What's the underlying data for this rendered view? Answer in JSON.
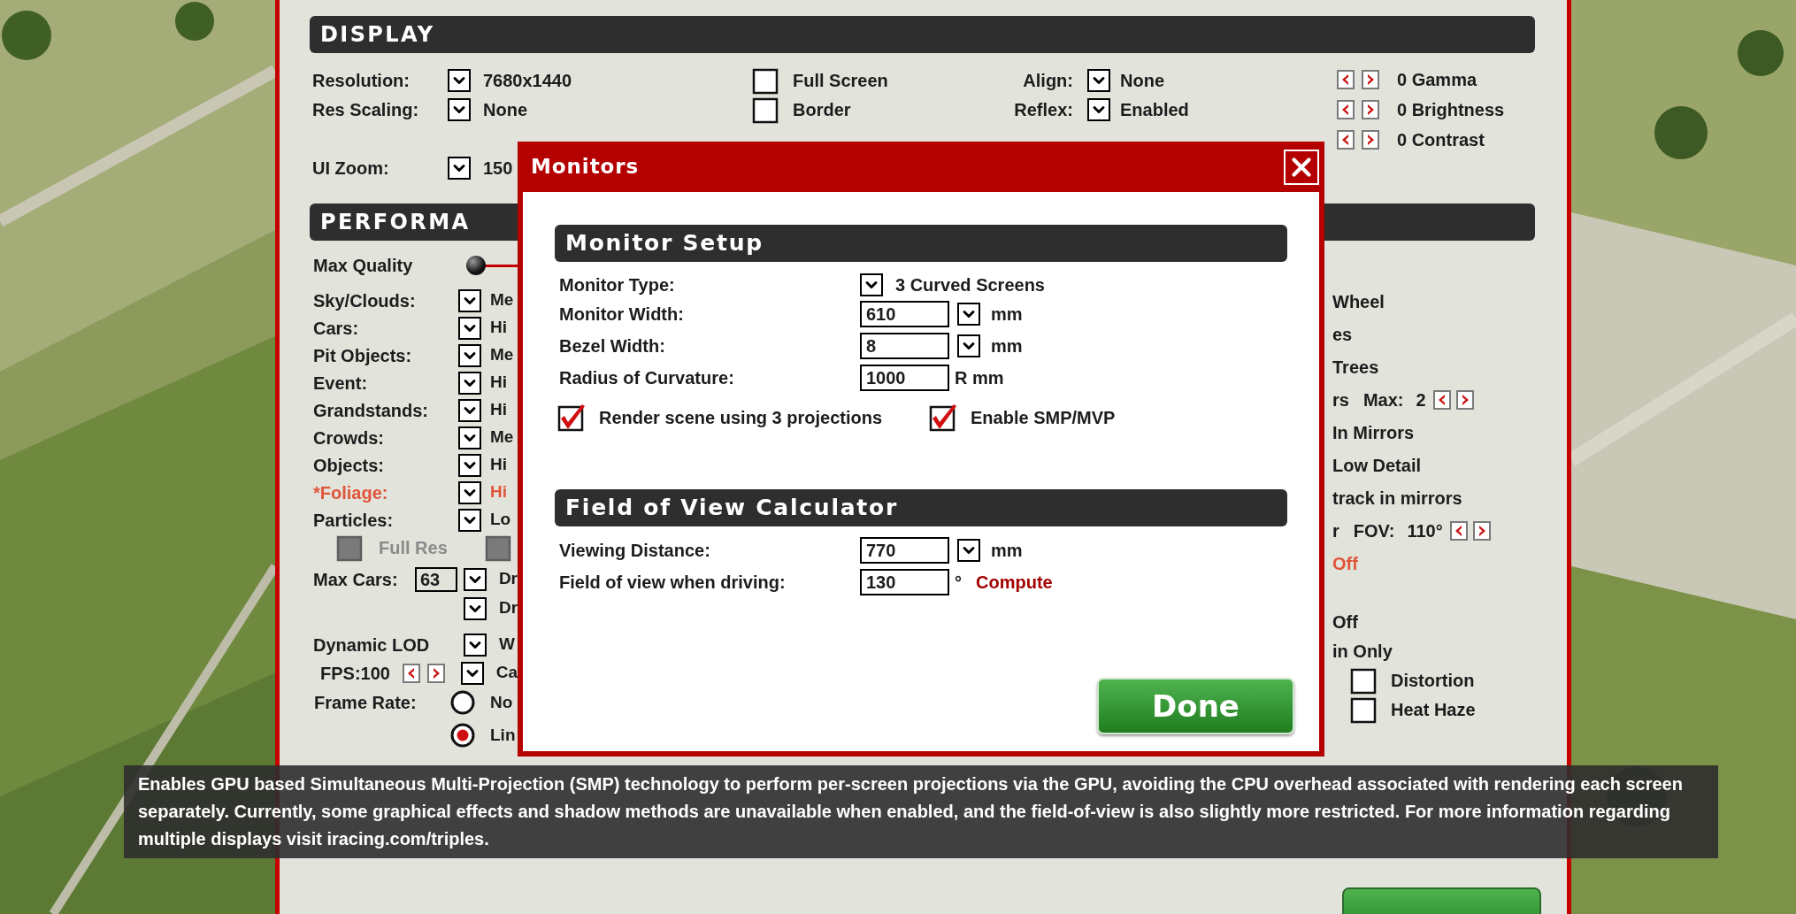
{
  "display": {
    "title": "DISPLAY",
    "left_rows": [
      {
        "label": "Resolution:",
        "value": "7680x1440"
      },
      {
        "label": "Res Scaling:",
        "value": "None"
      },
      {
        "label": "UI Zoom:",
        "value": "150"
      }
    ],
    "toggles": [
      {
        "label": "Full Screen",
        "checked": false
      },
      {
        "label": "Border",
        "checked": false
      }
    ],
    "options": [
      {
        "label": "Align:",
        "value": "None"
      },
      {
        "label": "Reflex:",
        "value": "Enabled"
      }
    ],
    "adjusters": [
      {
        "label": "0 Gamma"
      },
      {
        "label": "0 Brightness"
      },
      {
        "label": "0 Contrast"
      }
    ]
  },
  "performance": {
    "title": "PERFORMA",
    "quality": {
      "label": "Max Quality",
      "level": 0
    },
    "rows": [
      {
        "label": "Sky/Clouds:",
        "value": "Me",
        "highlighted": false
      },
      {
        "label": "Cars:",
        "value": "Hi",
        "highlighted": false
      },
      {
        "label": "Pit Objects:",
        "value": "Me",
        "highlighted": false
      },
      {
        "label": "Event:",
        "value": "Hi",
        "highlighted": false
      },
      {
        "label": "Grandstands:",
        "value": "Hi",
        "highlighted": false
      },
      {
        "label": "Crowds:",
        "value": "Me",
        "highlighted": false
      },
      {
        "label": "Objects:",
        "value": "Hi",
        "highlighted": false
      },
      {
        "label": "*Foliage:",
        "value": "Hi",
        "highlighted": true
      },
      {
        "label": "Particles:",
        "value": "Lo",
        "highlighted": false
      }
    ],
    "full_res": {
      "label": "Full Res",
      "checked": false,
      "disabled": true,
      "second_checked": false,
      "second_disabled": true
    },
    "max_cars": {
      "label": "Max Cars:",
      "field": "63",
      "value": "Dr"
    },
    "second_value": "Dr",
    "lod": {
      "label": "Dynamic LOD",
      "value": "W"
    },
    "fps": {
      "label": "FPS:100",
      "value": "Ca"
    },
    "frame_rate": {
      "label": "Frame Rate:",
      "options": [
        {
          "label": "No",
          "selected": false
        },
        {
          "label": "Lin",
          "selected": true
        }
      ]
    },
    "right_items": [
      {
        "kind": "text",
        "text": "Wheel",
        "highlighted": false
      },
      {
        "kind": "text",
        "text": "es",
        "highlighted": false
      },
      {
        "kind": "text",
        "text": "Trees",
        "highlighted": false
      },
      {
        "kind": "stepper",
        "prefix": "rs",
        "label": "Max:",
        "value": "2"
      },
      {
        "kind": "text",
        "text": "In Mirrors",
        "highlighted": false
      },
      {
        "kind": "text",
        "text": "Low Detail",
        "highlighted": false
      },
      {
        "kind": "text",
        "text": "track in mirrors",
        "highlighted": false
      },
      {
        "kind": "stepper",
        "prefix": "r",
        "label": "FOV:",
        "value": "110°"
      },
      {
        "kind": "text",
        "text": "Off",
        "highlighted": true
      },
      {
        "kind": "text",
        "text": "Off",
        "highlighted": false
      },
      {
        "kind": "text",
        "text": "in Only",
        "highlighted": false
      },
      {
        "kind": "checkbox",
        "text": "Distortion",
        "checked": false
      },
      {
        "kind": "checkbox",
        "text": "Heat Haze",
        "checked": false
      }
    ]
  },
  "dialog": {
    "title": "Monitors",
    "sections": [
      {
        "title": "Monitor Setup",
        "rows": [
          {
            "kind": "select",
            "label": "Monitor Type:",
            "value": "3 Curved Screens"
          },
          {
            "kind": "combo",
            "label": "Monitor Width:",
            "value": "610",
            "unit": "mm"
          },
          {
            "kind": "combo",
            "label": "Bezel Width:",
            "value": "8",
            "unit": "mm"
          },
          {
            "kind": "field",
            "label": "Radius of Curvature:",
            "value": "1000",
            "unit": "R mm"
          }
        ],
        "checks": [
          {
            "label": "Render scene using 3 projections",
            "checked": true
          },
          {
            "label": "Enable SMP/MVP",
            "checked": true
          }
        ]
      },
      {
        "title": "Field of View Calculator",
        "rows": [
          {
            "kind": "combo",
            "label": "Viewing Distance:",
            "value": "770",
            "unit": "mm"
          },
          {
            "kind": "field",
            "label": "Field of view when driving:",
            "value": "130",
            "unit": "°",
            "action": "Compute"
          }
        ]
      }
    ],
    "button": "Done"
  },
  "tooltip": "Enables GPU based Simultaneous Multi-Projection (SMP) technology to perform per-screen projections via the GPU, avoiding the CPU overhead associated with rendering each screen separately. Currently, some graphical effects and shadow methods are unavailable when enabled, and the field-of-view is also slightly more restricted. For more information regarding multiple displays visit iracing.com/triples."
}
